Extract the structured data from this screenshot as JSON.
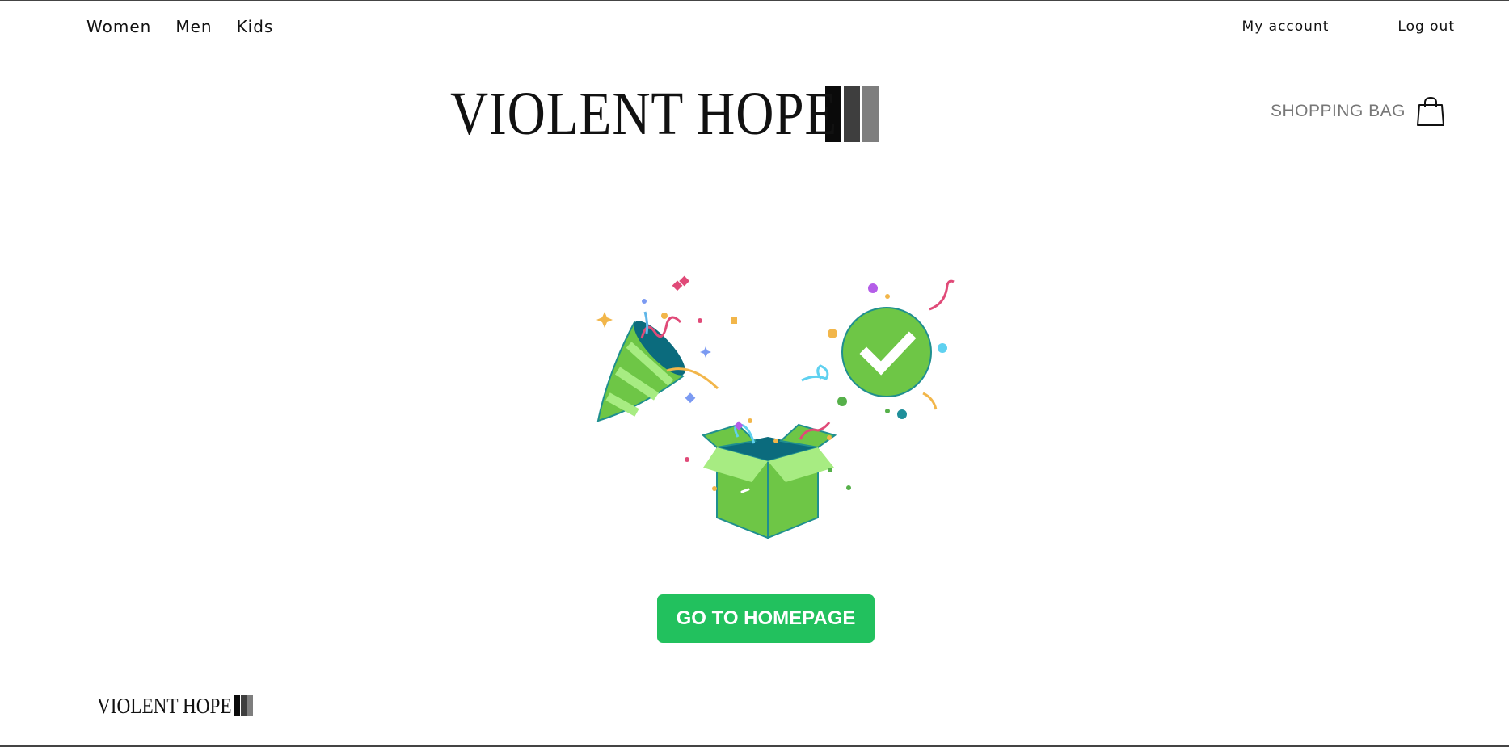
{
  "nav": {
    "categories": [
      "Women",
      "Men",
      "Kids"
    ],
    "my_account": "My account",
    "log_out": "Log out"
  },
  "brand": {
    "name": "VIOLENT HOPE",
    "bar_colors": [
      "#0a0a0a",
      "#3e3e3e",
      "#7e7e7e"
    ]
  },
  "bag": {
    "label": "SHOPPING BAG",
    "icon": "shopping-bag-icon"
  },
  "illustration": {
    "icons": [
      "party-popper-icon",
      "check-circle-icon",
      "open-gift-box-icon"
    ]
  },
  "cta": {
    "label": "GO TO HOMEPAGE",
    "color": "#22c15e"
  },
  "footer": {
    "brand": "VIOLENT HOPE"
  }
}
